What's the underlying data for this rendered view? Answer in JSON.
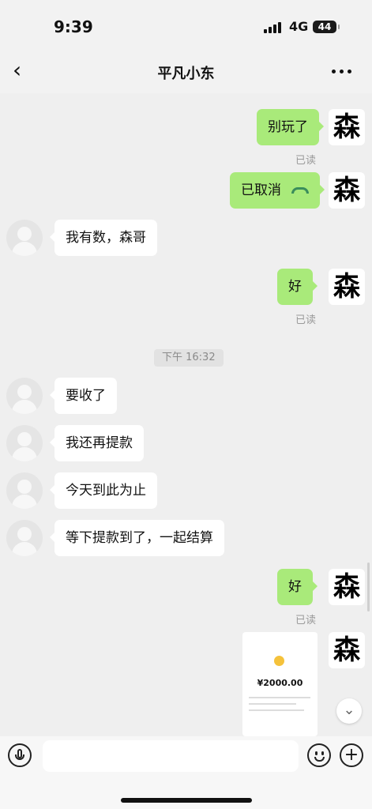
{
  "status_bar": {
    "time": "9:39",
    "network": "4G",
    "battery": "44"
  },
  "header": {
    "title": "平凡小东"
  },
  "timestamps": [
    "下午 16:32"
  ],
  "messages": [
    {
      "side": "right",
      "text": "别玩了",
      "read": "已读"
    },
    {
      "side": "right",
      "text": "已取消",
      "read": ""
    },
    {
      "side": "left",
      "text": "我有数，森哥"
    },
    {
      "side": "right",
      "text": "好",
      "read": "已读"
    },
    {
      "side": "left",
      "text": "要收了"
    },
    {
      "side": "left",
      "text": "我还再提款"
    },
    {
      "side": "left",
      "text": "今天到此为止"
    },
    {
      "side": "left",
      "text": "等下提款到了，一起结算"
    },
    {
      "side": "right",
      "text": "好",
      "read": "已读"
    }
  ],
  "image_message": {
    "amount": "¥2000.00"
  },
  "self_avatar": {
    "character": "森"
  },
  "icons": {
    "back": "chevron-left-icon",
    "more": "more-dots-icon",
    "voice": "microphone-icon",
    "emoji": "emoji-icon",
    "plus": "plus-icon",
    "scroll_down": "chevron-down-icon"
  }
}
